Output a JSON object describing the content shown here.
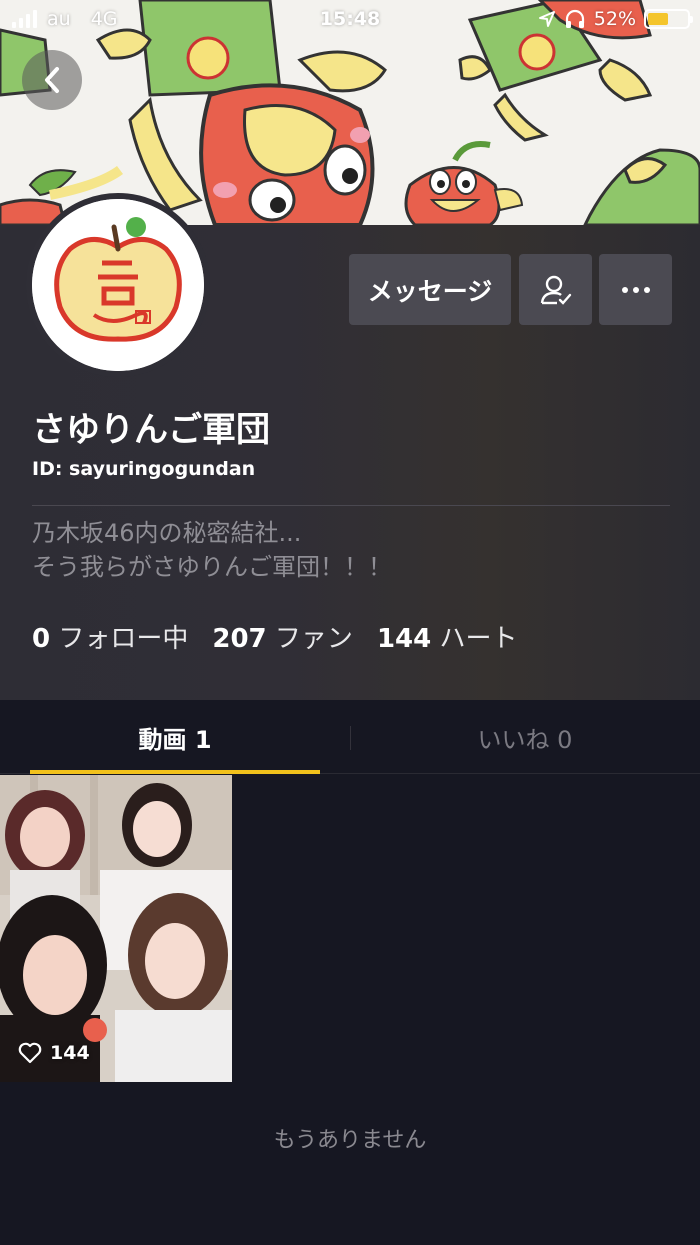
{
  "status_bar": {
    "carrier": "au",
    "network": "4G",
    "time": "15:48",
    "battery_percent": "52%",
    "battery_level": 0.52
  },
  "profile": {
    "display_name": "さゆりんご軍団",
    "user_id": "ID: sayuringogundan",
    "bio_line1": "乃木坂46内の秘密結社...",
    "bio_line2": "そう我らがさゆりんご軍団！！！",
    "following_count": "0",
    "following_label": "フォロー中",
    "fans_count": "207",
    "fans_label": "ファン",
    "hearts_count": "144",
    "hearts_label": "ハート"
  },
  "actions": {
    "message_label": "メッセージ",
    "follow_icon": "person-check-icon",
    "more_icon": "more-dots-icon"
  },
  "tabs": {
    "videos_label": "動画 1",
    "likes_label": "いいね 0"
  },
  "videos": [
    {
      "likes": "144"
    }
  ],
  "footer": {
    "no_more": "もうありません"
  },
  "colors": {
    "background": "#161722",
    "accent": "#f1c11c",
    "button": "#4b4a52"
  }
}
